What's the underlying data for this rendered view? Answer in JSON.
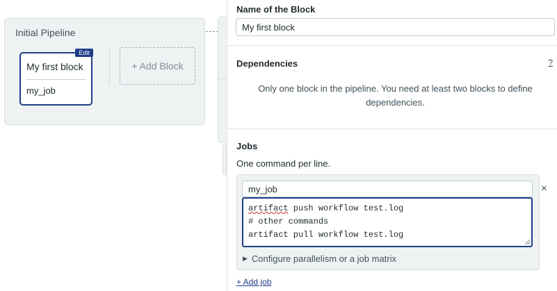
{
  "canvas": {
    "pipeline_title": "Initial Pipeline",
    "block": {
      "edit_label": "Edit",
      "name": "My first block",
      "job": "my_job"
    },
    "add_block_label": "+ Add Block"
  },
  "panel": {
    "name_section": {
      "title": "Name of the Block",
      "value": "My first block"
    },
    "dependencies": {
      "title": "Dependencies",
      "help": "?",
      "message": "Only one block in the pipeline. You need at least two blocks to define dependencies."
    },
    "jobs": {
      "title": "Jobs",
      "subtitle": "One command per line.",
      "job_name": "my_job",
      "commands": {
        "line1_word": "artifact",
        "line1_rest": " push workflow test.log",
        "line2": "# other commands",
        "line3": "artifact pull workflow test.log"
      },
      "config_label": "Configure parallelism or a job matrix",
      "remove_label": "×",
      "add_job_label": "+ Add job"
    }
  },
  "icons": {
    "expand": "triangle-right-icon",
    "remove": "close-icon"
  },
  "colors": {
    "accent": "#1f3d86",
    "panel_bg": "#eef2f3",
    "text": "#1f2a2e"
  }
}
